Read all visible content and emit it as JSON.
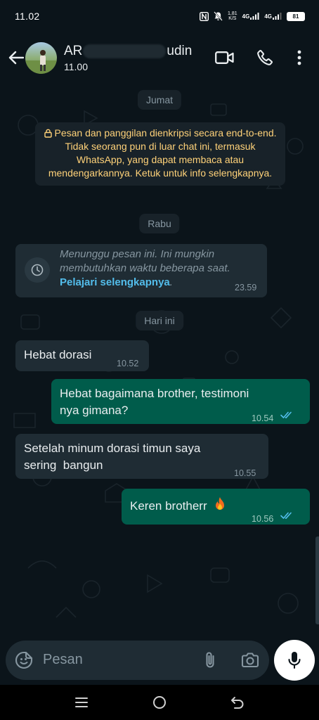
{
  "status_bar": {
    "time": "11.02",
    "net_speed_value": "1,81",
    "net_speed_unit": "K/S",
    "sim1_tag": "4G",
    "sim2_tag": "4G",
    "battery": "81"
  },
  "header": {
    "name_start": "AR",
    "name_end": "udin",
    "status": "11.00"
  },
  "chat": {
    "days": [
      "Jumat",
      "Rabu",
      "Hari ini"
    ],
    "encryption_notice": "Pesan dan panggilan dienkripsi secara end-to-end. Tidak seorang pun di luar chat ini, termasuk WhatsApp, yang dapat membaca atau mendengarkannya. Ketuk untuk info selengkapnya.",
    "waiting": {
      "text": "Menunggu pesan ini. Ini mungkin membutuhkan waktu beberapa saat.",
      "link": "Pelajari selengkapnya",
      "link_suffix": ".",
      "time": "23.59"
    },
    "messages": [
      {
        "direction": "incoming",
        "text": "Hebat dorasi",
        "time": "10.52"
      },
      {
        "direction": "outgoing",
        "text_line1": "Hebat bagaimana brother, testimoni",
        "text_line2": "nya gimana?",
        "time": "10.54",
        "read": true
      },
      {
        "direction": "incoming",
        "text_line1": "Setelah minum dorasi timun saya",
        "text_line2": "sering  bangun",
        "time": "10.55"
      },
      {
        "direction": "outgoing",
        "text": "Keren brotherr",
        "emoji": "fire",
        "time": "10.56",
        "read": true
      }
    ]
  },
  "input": {
    "placeholder": "Pesan"
  },
  "colors": {
    "background": "#0b141a",
    "incoming_bubble": "#1f2c34",
    "outgoing_bubble": "#005c4b",
    "encryption_text": "#ffd279",
    "link": "#53bdeb",
    "read_ticks": "#53bdeb"
  },
  "icons": {
    "header": [
      "back-arrow-icon",
      "video-call-icon",
      "voice-call-icon",
      "more-options-icon"
    ],
    "input": [
      "sticker-icon",
      "attach-icon",
      "camera-icon",
      "microphone-icon"
    ],
    "nav": [
      "recents-icon",
      "home-icon",
      "back-icon"
    ]
  }
}
